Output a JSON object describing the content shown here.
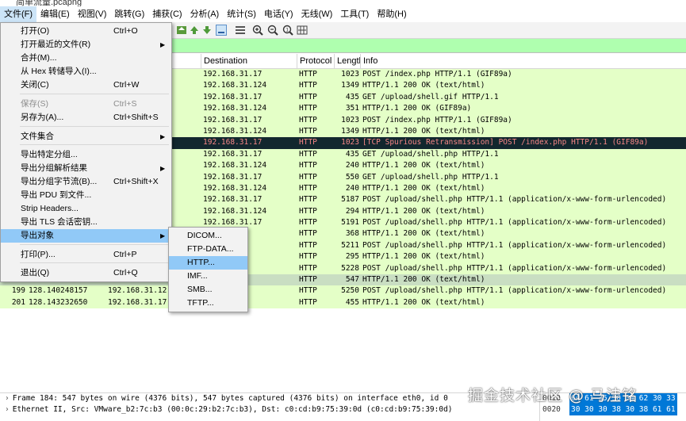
{
  "window": {
    "title": "简单流量.pcapng"
  },
  "menubar": [
    "文件(F)",
    "编辑(E)",
    "视图(V)",
    "跳转(G)",
    "捕获(C)",
    "分析(A)",
    "统计(S)",
    "电话(Y)",
    "无线(W)",
    "工具(T)",
    "帮助(H)"
  ],
  "packet_list": {
    "columns": {
      "destination": "Destination",
      "protocol": "Protocol",
      "length": "Length",
      "info": "Info"
    },
    "rows": [
      {
        "no": "",
        "time": "",
        "src": "",
        "dst": "192.168.31.17",
        "proto": "HTTP",
        "len": "1023",
        "info": "POST /index.php HTTP/1.1  (GIF89a)",
        "style": ""
      },
      {
        "no": "",
        "time": "",
        "src": "",
        "dst": "192.168.31.124",
        "proto": "HTTP",
        "len": "1349",
        "info": "HTTP/1.1 200 OK  (text/html)",
        "style": ""
      },
      {
        "no": "",
        "time": "",
        "src": "",
        "dst": "192.168.31.17",
        "proto": "HTTP",
        "len": "435",
        "info": "GET /upload/shell.gif HTTP/1.1",
        "style": ""
      },
      {
        "no": "",
        "time": "",
        "src": "",
        "dst": "192.168.31.124",
        "proto": "HTTP",
        "len": "351",
        "info": "HTTP/1.1 200 OK  (GIF89a)",
        "style": ""
      },
      {
        "no": "",
        "time": "",
        "src": "",
        "dst": "192.168.31.17",
        "proto": "HTTP",
        "len": "1023",
        "info": "POST /index.php HTTP/1.1  (GIF89a)",
        "style": ""
      },
      {
        "no": "",
        "time": "",
        "src": "",
        "dst": "192.168.31.124",
        "proto": "HTTP",
        "len": "1349",
        "info": "HTTP/1.1 200 OK  (text/html)",
        "style": ""
      },
      {
        "no": "",
        "time": "",
        "src": "",
        "dst": "192.168.31.17",
        "proto": "HTTP",
        "len": "1023",
        "info": "[TCP Spurious Retransmission] POST /index.php HTTP/1.1  (GIF89a)",
        "style": "dark"
      },
      {
        "no": "",
        "time": "",
        "src": "",
        "dst": "192.168.31.17",
        "proto": "HTTP",
        "len": "435",
        "info": "GET /upload/shell.php HTTP/1.1",
        "style": ""
      },
      {
        "no": "",
        "time": "",
        "src": "",
        "dst": "192.168.31.124",
        "proto": "HTTP",
        "len": "240",
        "info": "HTTP/1.1 200 OK  (text/html)",
        "style": ""
      },
      {
        "no": "",
        "time": "",
        "src": "",
        "dst": "192.168.31.17",
        "proto": "HTTP",
        "len": "550",
        "info": "GET /upload/shell.php HTTP/1.1",
        "style": ""
      },
      {
        "no": "",
        "time": "",
        "src": "",
        "dst": "192.168.31.124",
        "proto": "HTTP",
        "len": "240",
        "info": "HTTP/1.1 200 OK  (text/html)",
        "style": ""
      },
      {
        "no": "",
        "time": "",
        "src": "",
        "dst": "192.168.31.17",
        "proto": "HTTP",
        "len": "5187",
        "info": "POST /upload/shell.php HTTP/1.1  (application/x-www-form-urlencoded)",
        "style": ""
      },
      {
        "no": "",
        "time": "",
        "src": "",
        "dst": "192.168.31.124",
        "proto": "HTTP",
        "len": "294",
        "info": "HTTP/1.1 200 OK  (text/html)",
        "style": ""
      },
      {
        "no": "",
        "time": "",
        "src": "",
        "dst": "192.168.31.17",
        "proto": "HTTP",
        "len": "5191",
        "info": "POST /upload/shell.php HTTP/1.1  (application/x-www-form-urlencoded)",
        "style": ""
      },
      {
        "no": "",
        "time": "",
        "src": "",
        "dst": "",
        "proto": "HTTP",
        "len": "368",
        "info": "HTTP/1.1 200 OK  (text/html)",
        "style": ""
      },
      {
        "no": "",
        "time": "",
        "src": "",
        "dst": "",
        "proto": "HTTP",
        "len": "5211",
        "info": "POST /upload/shell.php HTTP/1.1  (application/x-www-form-urlencoded)",
        "style": ""
      },
      {
        "no": "",
        "time": "",
        "src": "",
        "dst": "",
        "proto": "HTTP",
        "len": "295",
        "info": "HTTP/1.1 200 OK  (text/html)",
        "style": ""
      },
      {
        "no": "",
        "time": "",
        "src": "",
        "dst": "",
        "proto": "HTTP",
        "len": "5228",
        "info": "POST /upload/shell.php HTTP/1.1  (application/x-www-form-urlencoded)",
        "style": ""
      },
      {
        "no": "",
        "time": "",
        "src": "",
        "dst": "",
        "proto": "HTTP",
        "len": "547",
        "info": "HTTP/1.1 200 OK  (text/html)",
        "style": "sel"
      },
      {
        "no": "199",
        "time": "128.140248157",
        "src": "192.168.31.12",
        "dst": "",
        "proto": "HTTP",
        "len": "5250",
        "info": "POST /upload/shell.php HTTP/1.1  (application/x-www-form-urlencoded)",
        "style": ""
      },
      {
        "no": "201",
        "time": "128.143232650",
        "src": "192.168.31.17",
        "dst": "",
        "proto": "HTTP",
        "len": "455",
        "info": "HTTP/1.1 200 OK  (text/html)",
        "style": ""
      }
    ]
  },
  "details": [
    "Frame 184: 547 bytes on wire (4376 bits), 547 bytes captured (4376 bits) on interface eth0, id 0",
    "Ethernet II, Src: VMware_b2:7c:b3 (00:0c:29:b2:7c:b3), Dst: c0:cd:b9:75:39:0d (c0:cd:b9:75:39:0d)"
  ],
  "hex": [
    {
      "offset": "0010",
      "bytes": "64 61 35 30 34 62 30 33"
    },
    {
      "offset": "0020",
      "bytes": "30 30 30 38 30 38 61 61"
    }
  ],
  "file_menu": {
    "items": [
      {
        "label": "打开(O)",
        "shortcut": "Ctrl+O",
        "submenu": false,
        "disabled": false,
        "highlight": false
      },
      {
        "label": "打开最近的文件(R)",
        "shortcut": "",
        "submenu": true,
        "disabled": false,
        "highlight": false
      },
      {
        "label": "合并(M)...",
        "shortcut": "",
        "submenu": false,
        "disabled": false,
        "highlight": false
      },
      {
        "label": "从 Hex 转储导入(I)...",
        "shortcut": "",
        "submenu": false,
        "disabled": false,
        "highlight": false
      },
      {
        "label": "关闭(C)",
        "shortcut": "Ctrl+W",
        "submenu": false,
        "disabled": false,
        "highlight": false
      },
      {
        "label": "保存(S)",
        "shortcut": "Ctrl+S",
        "submenu": false,
        "disabled": true,
        "highlight": false
      },
      {
        "label": "另存为(A)...",
        "shortcut": "Ctrl+Shift+S",
        "submenu": false,
        "disabled": false,
        "highlight": false
      },
      {
        "label": "文件集合",
        "shortcut": "",
        "submenu": true,
        "disabled": false,
        "highlight": false
      },
      {
        "label": "导出特定分组...",
        "shortcut": "",
        "submenu": false,
        "disabled": false,
        "highlight": false
      },
      {
        "label": "导出分组解析结果",
        "shortcut": "",
        "submenu": true,
        "disabled": false,
        "highlight": false
      },
      {
        "label": "导出分组字节流(B)...",
        "shortcut": "Ctrl+Shift+X",
        "submenu": false,
        "disabled": false,
        "highlight": false
      },
      {
        "label": "导出 PDU 到文件...",
        "shortcut": "",
        "submenu": false,
        "disabled": false,
        "highlight": false
      },
      {
        "label": "Strip Headers...",
        "shortcut": "",
        "submenu": false,
        "disabled": false,
        "highlight": false
      },
      {
        "label": "导出 TLS 会话密钥...",
        "shortcut": "",
        "submenu": false,
        "disabled": false,
        "highlight": false
      },
      {
        "label": "导出对象",
        "shortcut": "",
        "submenu": true,
        "disabled": false,
        "highlight": true
      },
      {
        "label": "打印(P)...",
        "shortcut": "Ctrl+P",
        "submenu": false,
        "disabled": false,
        "highlight": false
      },
      {
        "label": "退出(Q)",
        "shortcut": "Ctrl+Q",
        "submenu": false,
        "disabled": false,
        "highlight": false
      }
    ]
  },
  "export_objects_submenu": {
    "items": [
      {
        "label": "DICOM...",
        "highlight": false
      },
      {
        "label": "FTP-DATA...",
        "highlight": false
      },
      {
        "label": "HTTP...",
        "highlight": true
      },
      {
        "label": "IMF...",
        "highlight": false
      },
      {
        "label": "SMB...",
        "highlight": false
      },
      {
        "label": "TFTP...",
        "highlight": false
      }
    ]
  },
  "watermark": "掘金技术社区 @ 马洼铭"
}
